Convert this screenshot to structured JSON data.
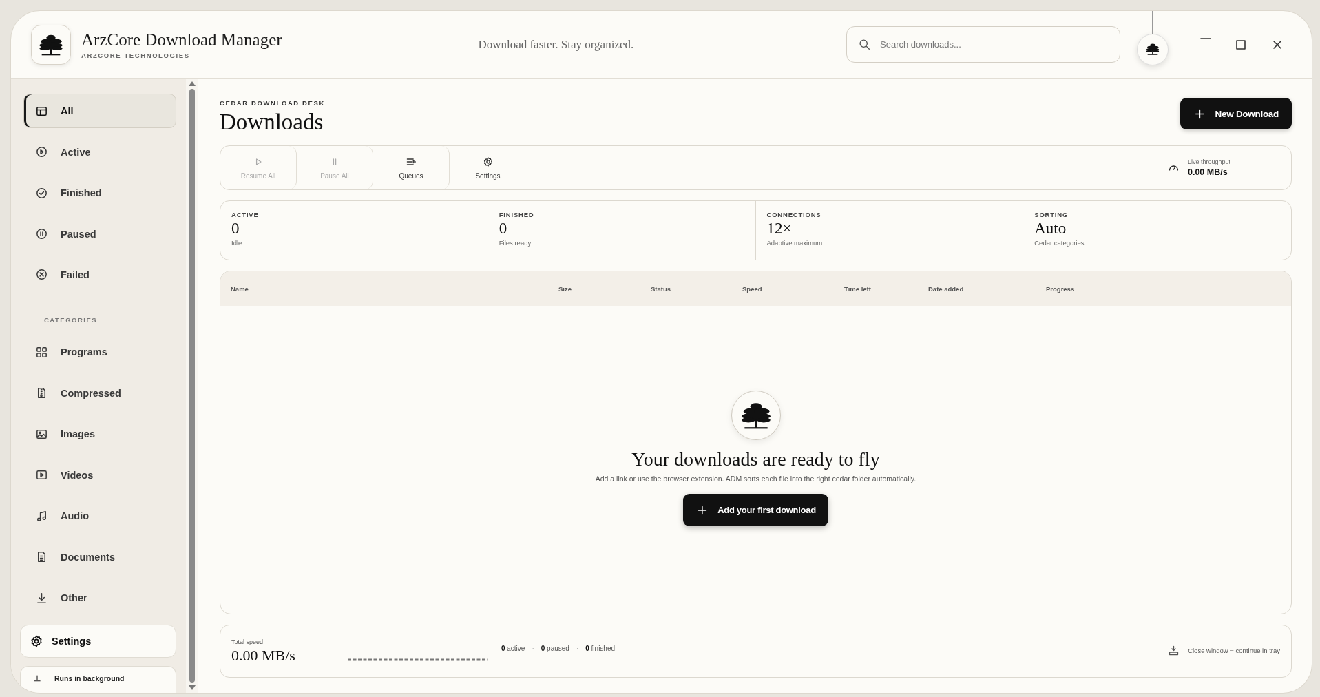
{
  "window": {
    "title": "ArzCore Download Manager",
    "subtitle": "ARZCORE TECHNOLOGIES",
    "tagline": "Download faster. Stay organized."
  },
  "search": {
    "placeholder": "Search downloads..."
  },
  "sidebar": {
    "items": [
      {
        "label": "All",
        "selected": true
      },
      {
        "label": "Active",
        "selected": false
      },
      {
        "label": "Finished",
        "selected": false
      },
      {
        "label": "Paused",
        "selected": false
      },
      {
        "label": "Failed",
        "selected": false
      }
    ],
    "categories_label": "CATEGORIES",
    "categories": [
      {
        "label": "Programs",
        "selected": false
      },
      {
        "label": "Compressed",
        "selected": false
      },
      {
        "label": "Images",
        "selected": false
      },
      {
        "label": "Videos",
        "selected": false
      },
      {
        "label": "Audio",
        "selected": false
      },
      {
        "label": "Documents",
        "selected": false
      },
      {
        "label": "Other",
        "selected": false
      }
    ],
    "settings": "Settings",
    "footer_note": "Runs in background"
  },
  "page": {
    "eyebrow": "CEDAR DOWNLOAD DESK",
    "title": "Downloads",
    "new_button": "New Download"
  },
  "toolbar": {
    "buttons": [
      {
        "label": "Resume All",
        "disabled": true
      },
      {
        "label": "Pause All",
        "disabled": true
      },
      {
        "label": "Queues",
        "disabled": false
      },
      {
        "label": "Settings",
        "disabled": false
      }
    ],
    "throughput_label": "Live throughput",
    "throughput": "0.00 MB/s"
  },
  "stats": [
    {
      "label": "ACTIVE",
      "value": "0",
      "note": "Idle"
    },
    {
      "label": "FINISHED",
      "value": "0",
      "note": "Files ready"
    },
    {
      "label": "CONNECTIONS",
      "value": "12×",
      "note": "Adaptive maximum"
    },
    {
      "label": "SORTING",
      "value": "Auto",
      "note": "Cedar categories"
    }
  ],
  "table": {
    "columns": [
      "Name",
      "Size",
      "Status",
      "Speed",
      "Time left",
      "Date added",
      "Progress"
    ]
  },
  "empty_state": {
    "title": "Your downloads are ready to fly",
    "text": "Add a link or use the browser extension. ADM sorts each file into the right cedar folder automatically.",
    "button": "Add your first download"
  },
  "status_bar": {
    "total_label": "Total speed",
    "total": "0.00 MB/s",
    "separator": "·",
    "counts": [
      {
        "count": "0",
        "label": "active"
      },
      {
        "count": "0",
        "label": "paused"
      },
      {
        "count": "0",
        "label": "finished"
      }
    ],
    "tray_note": "Close window = continue in tray"
  }
}
